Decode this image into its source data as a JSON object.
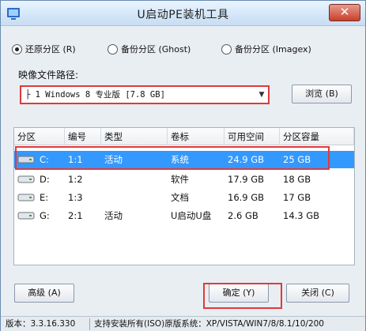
{
  "window": {
    "title": "U启动PE装机工具",
    "close_symbol": "✕"
  },
  "options": {
    "restore": "还原分区 (R)",
    "backup_ghost": "备份分区 (Ghost)",
    "backup_imagex": "备份分区 (Imagex)",
    "selected": "restore"
  },
  "image_path": {
    "label": "映像文件路径:",
    "value": "├ 1 Windows 8 专业版 [7.8 GB]",
    "browse": "浏览 (B)"
  },
  "table": {
    "headers": [
      "分区",
      "编号",
      "类型",
      "卷标",
      "可用空间",
      "分区容量"
    ],
    "rows": [
      {
        "drive": "C:",
        "num": "1:1",
        "type": "活动",
        "label": "系统",
        "free": "24.9 GB",
        "size": "25 GB"
      },
      {
        "drive": "D:",
        "num": "1:2",
        "type": "",
        "label": "软件",
        "free": "17.9 GB",
        "size": "18 GB"
      },
      {
        "drive": "E:",
        "num": "1:3",
        "type": "",
        "label": "文档",
        "free": "16.9 GB",
        "size": "17 GB"
      },
      {
        "drive": "G:",
        "num": "2:1",
        "type": "活动",
        "label": "U启动U盘",
        "free": "2.6 GB",
        "size": "14.3 GB"
      }
    ],
    "selected_row": 0
  },
  "buttons": {
    "advanced": "高级 (A)",
    "ok": "确定 (Y)",
    "close": "关闭 (C)"
  },
  "status": {
    "version": "版本：3.3.16.330",
    "support": "支持安装所有(ISO)原版系统：XP/VISTA/WIN7/8/8.1/10/200"
  },
  "colors": {
    "highlight": "#3399ff",
    "annotation": "#e03a3a"
  }
}
